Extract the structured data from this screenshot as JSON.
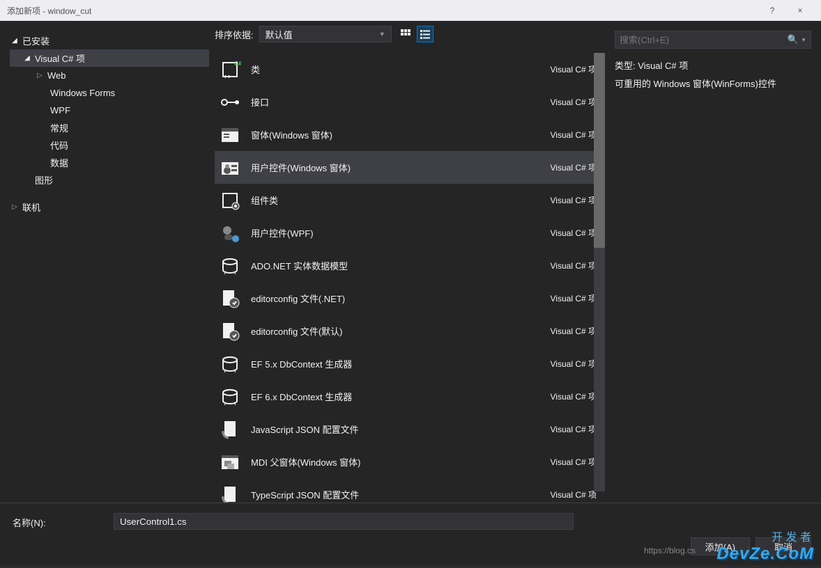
{
  "window": {
    "title": "添加新项 - window_cut",
    "help": "?",
    "close": "×"
  },
  "sidebar": {
    "installed": "已安装",
    "csharp": "Visual C# 项",
    "items": [
      "Web",
      "Windows Forms",
      "WPF",
      "常规",
      "代码",
      "数据"
    ],
    "graphics": "图形",
    "online": "联机"
  },
  "toolbar": {
    "sort_label": "排序依据:",
    "sort_value": "默认值"
  },
  "templates": [
    {
      "name": "类",
      "lang": "Visual C# 项",
      "icon": "class"
    },
    {
      "name": "接口",
      "lang": "Visual C# 项",
      "icon": "interface"
    },
    {
      "name": "窗体(Windows 窗体)",
      "lang": "Visual C# 项",
      "icon": "form"
    },
    {
      "name": "用户控件(Windows 窗体)",
      "lang": "Visual C# 项",
      "icon": "usercontrol",
      "selected": true
    },
    {
      "name": "组件类",
      "lang": "Visual C# 项",
      "icon": "component"
    },
    {
      "name": "用户控件(WPF)",
      "lang": "Visual C# 项",
      "icon": "wpfcontrol"
    },
    {
      "name": "ADO.NET 实体数据模型",
      "lang": "Visual C# 项",
      "icon": "ado"
    },
    {
      "name": "editorconfig 文件(.NET)",
      "lang": "Visual C# 项",
      "icon": "editorconfig"
    },
    {
      "name": "editorconfig 文件(默认)",
      "lang": "Visual C# 项",
      "icon": "editorconfig"
    },
    {
      "name": "EF 5.x DbContext 生成器",
      "lang": "Visual C# 项",
      "icon": "ado"
    },
    {
      "name": "EF 6.x DbContext 生成器",
      "lang": "Visual C# 项",
      "icon": "ado"
    },
    {
      "name": "JavaScript JSON 配置文件",
      "lang": "Visual C# 项",
      "icon": "json"
    },
    {
      "name": "MDI 父窗体(Windows 窗体)",
      "lang": "Visual C# 项",
      "icon": "mdi"
    },
    {
      "name": "TypeScript JSON 配置文件",
      "lang": "Visual C# 项",
      "icon": "json"
    }
  ],
  "details": {
    "search_placeholder": "搜索(Ctrl+E)",
    "type_label": "类型:",
    "type_value": "Visual C# 项",
    "description": "可重用的 Windows 窗体(WinForms)控件"
  },
  "bottom": {
    "name_label": "名称(N):",
    "name_value": "UserControl1.cs",
    "add": "添加(A)",
    "cancel": "取消"
  },
  "watermark": {
    "top": "开 发 者",
    "main": "DevZe.CoM",
    "url": "https://blog.cs"
  }
}
